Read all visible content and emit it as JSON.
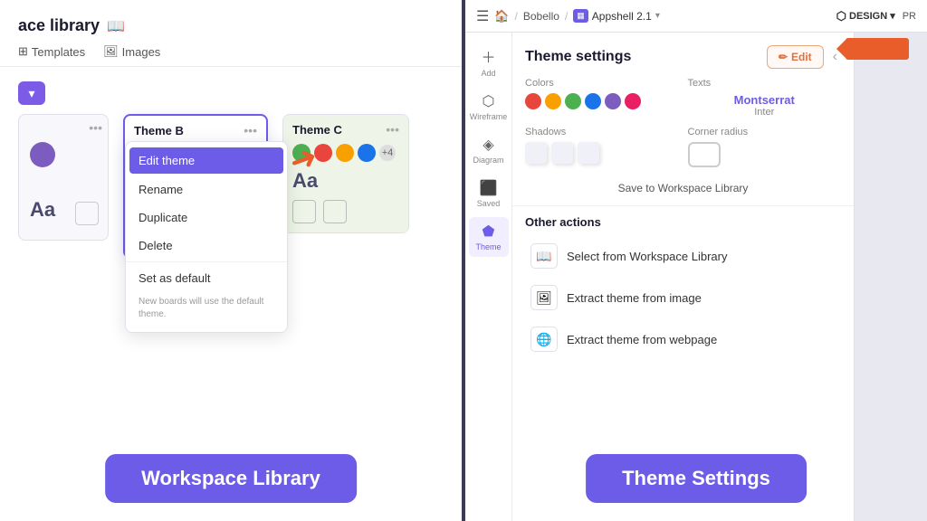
{
  "left_panel": {
    "title": "ace library",
    "tabs": [
      {
        "label": "Templates",
        "icon": "⊞"
      },
      {
        "label": "Images",
        "icon": "🖼"
      }
    ],
    "cards": [
      {
        "id": "blank",
        "colors": [
          "#7c5cbf"
        ]
      },
      {
        "id": "theme-b",
        "title": "Theme B",
        "colors": [
          "#7c5cbf",
          "#e8453c",
          "#f7a000",
          "#4caf50",
          "#1a73e8"
        ],
        "context_menu": {
          "items": [
            {
              "label": "Edit theme",
              "highlighted": true
            },
            {
              "label": "Rename"
            },
            {
              "label": "Duplicate"
            },
            {
              "label": "Delete"
            },
            {
              "label": "Set as default"
            }
          ],
          "note": "New boards will use the default theme."
        }
      },
      {
        "id": "theme-c",
        "title": "Theme C",
        "colors": [
          "#4caf50",
          "#e8453c",
          "#f7a000",
          "#1a73e8"
        ],
        "plus_count": "+4"
      }
    ],
    "bottom_label": "Workspace Library"
  },
  "right_panel": {
    "breadcrumb": {
      "home": "🏠",
      "separator": "/",
      "workspace": "Bobello",
      "separator2": "/",
      "app_icon": "▦",
      "app_name": "Appshell 2.1",
      "chevron": "▾"
    },
    "top_right": {
      "design_label": "DESIGN",
      "pr_label": "PR"
    },
    "sidebar_icons": [
      {
        "id": "add",
        "symbol": "＋",
        "label": "Add"
      },
      {
        "id": "wireframe",
        "symbol": "⬡",
        "label": "Wireframe"
      },
      {
        "id": "diagram",
        "symbol": "⬢",
        "label": "Diagram"
      },
      {
        "id": "saved",
        "symbol": "💾",
        "label": "Saved"
      },
      {
        "id": "theme",
        "symbol": "🎨",
        "label": "Theme",
        "active": true
      }
    ],
    "theme_settings": {
      "title": "Theme settings",
      "edit_btn": "Edit",
      "edit_icon": "✏",
      "colors_label": "Colors",
      "colors": [
        "#e8453c",
        "#f7a000",
        "#4caf50",
        "#1a73e8",
        "#7c5cbf",
        "#9b59b6"
      ],
      "texts_label": "Texts",
      "font_primary": "Montserrat",
      "font_secondary": "Inter",
      "shadows_label": "Shadows",
      "corner_radius_label": "Corner radius",
      "save_library_btn": "Save to Workspace Library",
      "other_actions": {
        "title": "Other actions",
        "items": [
          {
            "id": "select-library",
            "icon": "📖",
            "label": "Select from Workspace Library"
          },
          {
            "id": "extract-image",
            "icon": "🖼",
            "label": "Extract theme from image"
          },
          {
            "id": "extract-webpage",
            "icon": "🌐",
            "label": "Extract theme from webpage"
          }
        ]
      }
    },
    "bottom_label": "Theme Settings"
  }
}
